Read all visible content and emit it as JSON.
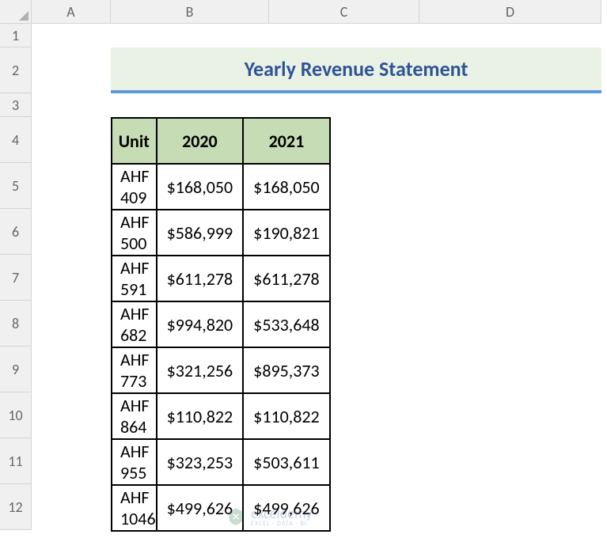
{
  "columns": [
    "A",
    "B",
    "C",
    "D"
  ],
  "rows": [
    "1",
    "2",
    "3",
    "4",
    "5",
    "6",
    "7",
    "8",
    "9",
    "10",
    "11",
    "12"
  ],
  "title": "Yearly Revenue Statement",
  "headers": {
    "unit": "Unit",
    "y2020": "2020",
    "y2021": "2021"
  },
  "currency": "$",
  "data": [
    {
      "unit": "AHF 409",
      "y2020": "168,050",
      "y2021": "168,050"
    },
    {
      "unit": "AHF 500",
      "y2020": "586,999",
      "y2021": "190,821"
    },
    {
      "unit": "AHF 591",
      "y2020": "611,278",
      "y2021": "611,278"
    },
    {
      "unit": "AHF 682",
      "y2020": "994,820",
      "y2021": "533,648"
    },
    {
      "unit": "AHF 773",
      "y2020": "321,256",
      "y2021": "895,373"
    },
    {
      "unit": "AHF 864",
      "y2020": "110,822",
      "y2021": "110,822"
    },
    {
      "unit": "AHF 955",
      "y2020": "323,253",
      "y2021": "503,611"
    },
    {
      "unit": "AHF 1046",
      "y2020": "499,626",
      "y2021": "499,626"
    }
  ],
  "watermark": {
    "main": "exceldemy",
    "sub": "EXCEL · DATA · BI"
  }
}
